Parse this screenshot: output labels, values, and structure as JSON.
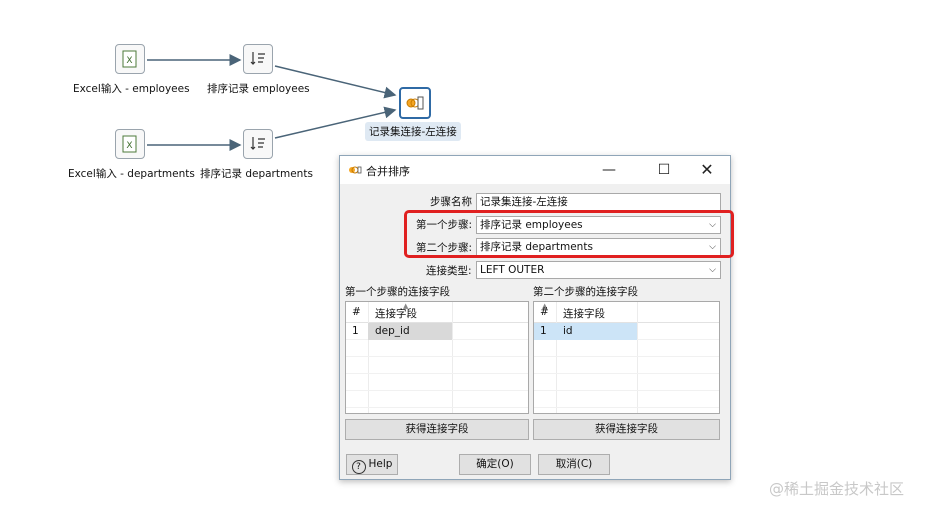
{
  "canvas": {
    "steps": [
      {
        "label": "Excel输入 - employees",
        "icon": "excel-icon"
      },
      {
        "label": "排序记录 employees",
        "icon": "sort-icon"
      },
      {
        "label": "Excel输入 - departments",
        "icon": "excel-icon"
      },
      {
        "label": "排序记录  departments",
        "icon": "sort-icon"
      },
      {
        "label": "记录集连接-左连接",
        "icon": "merge-join-icon"
      }
    ]
  },
  "dialog": {
    "title": "合并排序",
    "step_name_label": "步骤名称",
    "step_name_value": "记录集连接-左连接",
    "first_step_label": "第一个步骤:",
    "first_step_value": "排序记录 employees",
    "second_step_label": "第二个步骤:",
    "second_step_value": "排序记录  departments",
    "join_type_label": "连接类型:",
    "join_type_value": "LEFT OUTER",
    "left_grid": {
      "title": "第一个步骤的连接字段",
      "col_num": "#",
      "col_field": "连接字段",
      "rows": [
        {
          "num": "1",
          "field": "dep_id"
        }
      ],
      "get_button": "获得连接字段"
    },
    "right_grid": {
      "title": "第二个步骤的连接字段",
      "col_num": "#",
      "col_field": "连接字段",
      "rows": [
        {
          "num": "1",
          "field": "id"
        }
      ],
      "get_button": "获得连接字段"
    },
    "help_button": "Help",
    "ok_button": "确定(O)",
    "cancel_button": "取消(C)"
  },
  "watermark": "@稀土掘金技术社区",
  "colors": {
    "highlight": "#e02020",
    "selection": "#cce4f7",
    "accent": "#2f6aa5"
  }
}
